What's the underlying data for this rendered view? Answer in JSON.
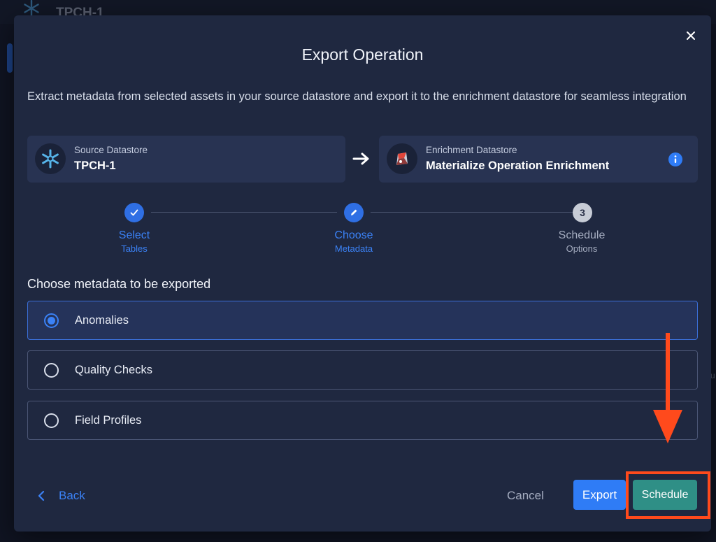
{
  "background": {
    "title": "TPCH-1"
  },
  "modal": {
    "title": "Export Operation",
    "description": "Extract metadata from selected assets in your source datastore and export it to the enrichment datastore for seamless integration"
  },
  "source": {
    "label": "Source Datastore",
    "name": "TPCH-1"
  },
  "enrichment": {
    "label": "Enrichment Datastore",
    "name": "Materialize Operation Enrichment"
  },
  "steps": [
    {
      "title": "Select",
      "subtitle": "Tables",
      "state": "done"
    },
    {
      "title": "Choose",
      "subtitle": "Metadata",
      "state": "active"
    },
    {
      "title": "Schedule",
      "subtitle": "Options",
      "state": "pending",
      "number": "3"
    }
  ],
  "section": {
    "title": "Choose metadata to be exported"
  },
  "options": [
    {
      "label": "Anomalies",
      "selected": true
    },
    {
      "label": "Quality Checks",
      "selected": false
    },
    {
      "label": "Field Profiles",
      "selected": false
    }
  ],
  "footer": {
    "back_label": "Back",
    "cancel_label": "Cancel",
    "export_label": "Export",
    "schedule_label": "Schedule"
  },
  "colors": {
    "accent_blue": "#2f7cf6",
    "schedule_teal": "#2f8f86",
    "annotation_orange": "#ff4a1c",
    "modal_bg": "#1f2840"
  },
  "icons": {
    "source": "snowflake-icon",
    "enrichment": "enrichment-logo-icon",
    "info": "info-icon",
    "close": "close-icon",
    "back": "chevron-left-icon"
  }
}
